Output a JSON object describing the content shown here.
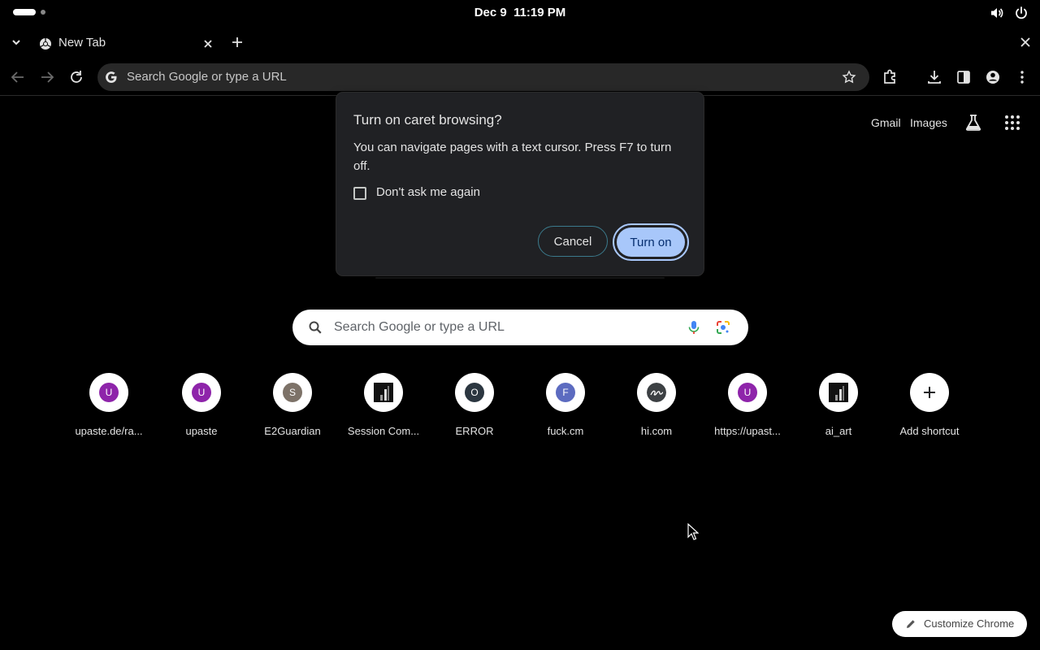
{
  "topbar": {
    "clock_date": "Dec 9",
    "clock_time": "11:19 PM",
    "icons": [
      "volume-icon",
      "power-icon"
    ]
  },
  "tabs": {
    "active_title": "New Tab",
    "icons": [
      "chevron-down-icon",
      "chrome-icon",
      "close-icon",
      "plus-icon",
      "window-close-icon"
    ]
  },
  "toolbar": {
    "omnibox_text": "Search Google or type a URL",
    "icons": [
      "back-icon",
      "forward-icon",
      "reload-icon",
      "google-icon",
      "star-icon",
      "extensions-icon",
      "download-icon",
      "side-panel-icon",
      "profile-icon",
      "menu-icon"
    ]
  },
  "ntp": {
    "gmail": "Gmail",
    "images": "Images",
    "search_placeholder": "Search Google or type a URL",
    "customize_label": "Customize Chrome",
    "shortcuts": [
      {
        "label": "upaste.de/ra...",
        "letter": "U",
        "color": "#8e24aa"
      },
      {
        "label": "upaste",
        "letter": "U",
        "color": "#8e24aa"
      },
      {
        "label": "E2Guardian",
        "letter": "S",
        "color": "#7d7268"
      },
      {
        "label": "Session Com...",
        "letter": "",
        "color": "#111111"
      },
      {
        "label": "ERROR",
        "letter": "O",
        "color": "#2b3640"
      },
      {
        "label": "fuck.cm",
        "letter": "F",
        "color": "#5c6bc0"
      },
      {
        "label": "hi.com",
        "letter": "",
        "color": "#3c4043"
      },
      {
        "label": "https://upast...",
        "letter": "U",
        "color": "#8e24aa"
      },
      {
        "label": "ai_art",
        "letter": "",
        "color": "#111111"
      },
      {
        "label": "Add shortcut",
        "letter": "+",
        "color": "#ffffff"
      }
    ]
  },
  "dialog": {
    "title": "Turn on caret browsing?",
    "body": "You can navigate pages with a text cursor. Press F7 to turn off.",
    "checkbox_label": "Don't ask me again",
    "checkbox_checked": false,
    "cancel_label": "Cancel",
    "confirm_label": "Turn on"
  }
}
